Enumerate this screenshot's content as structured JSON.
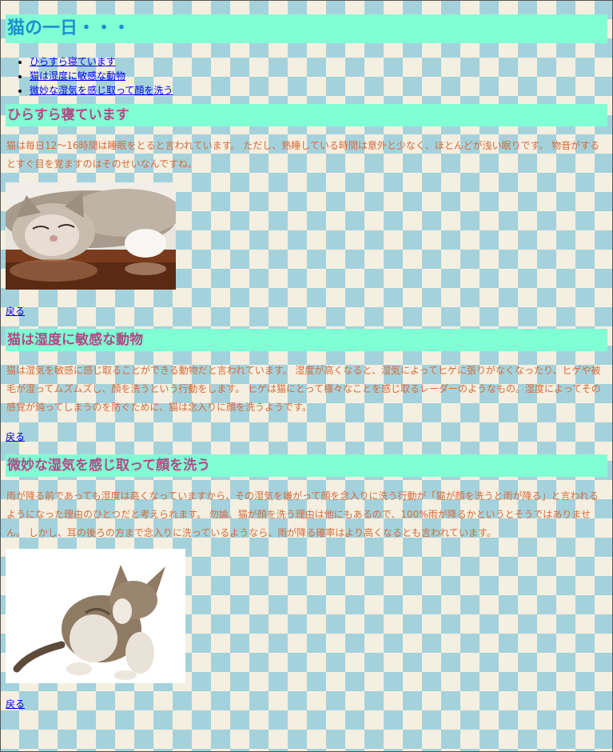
{
  "title": "猫の一日・・・",
  "toc": [
    {
      "label": "ひらすら寝ています"
    },
    {
      "label": "猫は湿度に敏感な動物"
    },
    {
      "label": "微妙な湿気を感じ取って顔を洗う"
    }
  ],
  "sections": [
    {
      "heading": "ひらすら寝ています",
      "text": "猫は毎日12～16時間は睡眠をとると言われています。 ただし、熟睡している時間は意外と少なく、ほとんどが浅い眠りです。 物音がするとすぐ目を覚ますのはそのせいなんですね。",
      "back": "戻る"
    },
    {
      "heading": "猫は湿度に敏感な動物",
      "text": "猫は湿気を敏感に感じ取ることができる動物だと言われています。 湿度が高くなると、湿気によってヒゲに張りがなくなったり、ヒゲや被毛が湿ってムズムズし、顔を洗うという行動をします。 ヒゲは猫にとって様々なことを感じ取るレーダーのようなもの。湿度によってその感覚が鈍ってしまうのを防ぐために、猫は念入りに顔を洗うようです。",
      "back": "戻る"
    },
    {
      "heading": "微妙な湿気を感じ取って顔を洗う",
      "text": "雨が降る前であっても湿度は高くなっていますから、その湿気を嫌がって顔を念入りに洗う行動が「猫が顔を洗うと雨が降る」と言われるようになった理由のひとつだと考えられます。 勿論、猫が顔を洗う理由は他にもあるので、100%雨が降るかというとそうではありません。 しかし、耳の後ろの方まで念入りに洗っているようなら、雨が降る確率はより高くなるとも言われています。",
      "back": "戻る"
    }
  ]
}
